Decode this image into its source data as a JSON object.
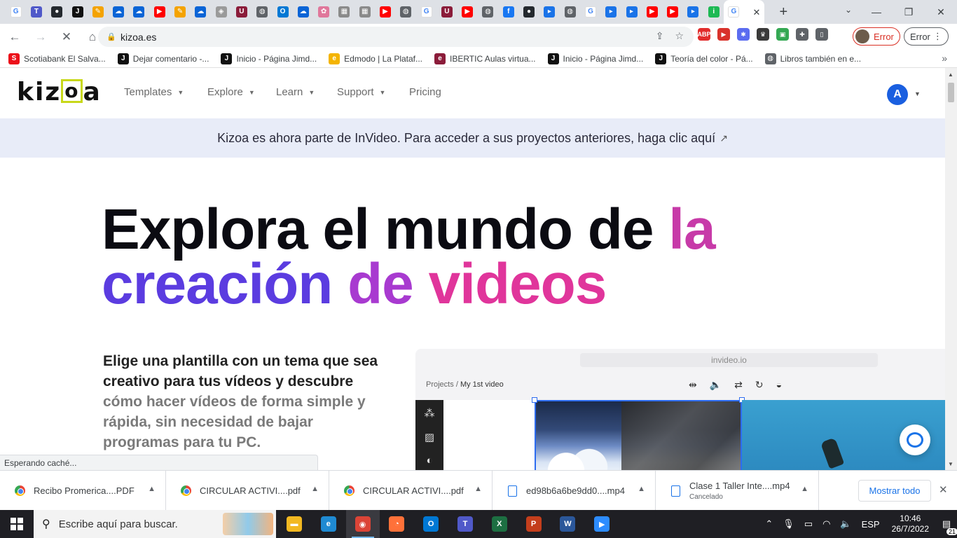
{
  "browser": {
    "tabs": [
      {
        "icon": "google-icon",
        "color": "#ffffff",
        "glyph": "G"
      },
      {
        "icon": "teams-icon",
        "color": "#5059c9",
        "glyph": "T"
      },
      {
        "icon": "github-icon",
        "color": "#24292e",
        "glyph": "●"
      },
      {
        "icon": "jimdo-icon",
        "color": "#111111",
        "glyph": "J"
      },
      {
        "icon": "pencil-icon",
        "color": "#f4a300",
        "glyph": "✎"
      },
      {
        "icon": "onedrive-icon",
        "color": "#0a64d6",
        "glyph": "☁"
      },
      {
        "icon": "onedrive-icon",
        "color": "#0a64d6",
        "glyph": "☁"
      },
      {
        "icon": "youtube-icon",
        "color": "#ff0000",
        "glyph": "▶"
      },
      {
        "icon": "pencil-icon",
        "color": "#f4a300",
        "glyph": "✎"
      },
      {
        "icon": "onedrive-icon",
        "color": "#0a64d6",
        "glyph": "☁"
      },
      {
        "icon": "crest-icon",
        "color": "#9a9a9a",
        "glyph": "◈"
      },
      {
        "icon": "u-icon",
        "color": "#8b1c3a",
        "glyph": "U"
      },
      {
        "icon": "globe-icon",
        "color": "#5f6368",
        "glyph": "◍"
      },
      {
        "icon": "outlook-icon",
        "color": "#0078d4",
        "glyph": "O"
      },
      {
        "icon": "onedrive-icon",
        "color": "#0a64d6",
        "glyph": "☁"
      },
      {
        "icon": "brain-icon",
        "color": "#e0779b",
        "glyph": "✿"
      },
      {
        "icon": "grid-icon",
        "color": "#8a8a8a",
        "glyph": "▦"
      },
      {
        "icon": "grid-icon",
        "color": "#8a8a8a",
        "glyph": "▦"
      },
      {
        "icon": "youtube-icon",
        "color": "#ff0000",
        "glyph": "▶"
      },
      {
        "icon": "globe-icon",
        "color": "#5f6368",
        "glyph": "◍"
      },
      {
        "icon": "google-icon",
        "color": "#ffffff",
        "glyph": "G"
      },
      {
        "icon": "u-icon",
        "color": "#8b1c3a",
        "glyph": "U"
      },
      {
        "icon": "youtube-icon",
        "color": "#ff0000",
        "glyph": "▶"
      },
      {
        "icon": "globe-icon",
        "color": "#5f6368",
        "glyph": "◍"
      },
      {
        "icon": "facebook-icon",
        "color": "#1877f2",
        "glyph": "f"
      },
      {
        "icon": "github-icon",
        "color": "#24292e",
        "glyph": "●"
      },
      {
        "icon": "play-icon",
        "color": "#1a73e8",
        "glyph": "▸"
      },
      {
        "icon": "globe-icon",
        "color": "#5f6368",
        "glyph": "◍"
      },
      {
        "icon": "google-icon",
        "color": "#ffffff",
        "glyph": "G"
      },
      {
        "icon": "play-icon",
        "color": "#1a73e8",
        "glyph": "▸"
      },
      {
        "icon": "play-icon",
        "color": "#1a73e8",
        "glyph": "▸"
      },
      {
        "icon": "youtube-icon",
        "color": "#ff0000",
        "glyph": "▶"
      },
      {
        "icon": "youtube-icon",
        "color": "#ff0000",
        "glyph": "▶"
      },
      {
        "icon": "play-icon",
        "color": "#1a73e8",
        "glyph": "▸"
      },
      {
        "icon": "invideo-icon",
        "color": "#1db954",
        "glyph": "i"
      }
    ],
    "active_tab": {
      "icon": "google-icon",
      "close": "✕"
    },
    "new_tab": "+",
    "window_controls": [
      "—",
      "❐",
      "✕"
    ],
    "tab_search": "⌄",
    "nav": {
      "back": "←",
      "forward": "→",
      "reload": "✕",
      "home": "⌂"
    },
    "url": "kizoa.es",
    "profile_status": "Error",
    "error_button": "Error",
    "extensions": [
      {
        "name": "adblock-icon",
        "color": "#e22c2c",
        "glyph": "ABP"
      },
      {
        "name": "screencast-icon",
        "color": "#d9322b",
        "glyph": "▶"
      },
      {
        "name": "flower-icon",
        "color": "#5b6cf0",
        "glyph": "✱"
      },
      {
        "name": "crown-icon",
        "color": "#3a3a3a",
        "glyph": "♛"
      },
      {
        "name": "green-ext-icon",
        "color": "#34a853",
        "glyph": "▣"
      },
      {
        "name": "puzzle-icon",
        "color": "#5f6368",
        "glyph": "✚"
      },
      {
        "name": "sidepanel-icon",
        "color": "#5f6368",
        "glyph": "▯"
      }
    ],
    "bookmarks": [
      {
        "label": "Scotiabank El Salva...",
        "color": "#ec111a",
        "glyph": "S",
        "icon": "scotiabank-icon"
      },
      {
        "label": "Dejar comentario -...",
        "color": "#111111",
        "glyph": "J",
        "icon": "jimdo-icon"
      },
      {
        "label": "Inicio - Página Jimd...",
        "color": "#111111",
        "glyph": "J",
        "icon": "jimdo-icon"
      },
      {
        "label": "Edmodo | La Plataf...",
        "color": "#f4b400",
        "glyph": "e",
        "icon": "edmodo-icon"
      },
      {
        "label": "IBERTIC Aulas virtua...",
        "color": "#8b1c3a",
        "glyph": "e",
        "icon": "ibertic-icon"
      },
      {
        "label": "Inicio - Página Jimd...",
        "color": "#111111",
        "glyph": "J",
        "icon": "jimdo-icon"
      },
      {
        "label": "Teoría del color - Pá...",
        "color": "#111111",
        "glyph": "J",
        "icon": "jimdo-icon"
      },
      {
        "label": "Libros también en e...",
        "color": "#5f6368",
        "glyph": "◍",
        "icon": "globe-icon"
      }
    ],
    "bookmarks_more": "»",
    "status": "Esperando caché..."
  },
  "site": {
    "logo": "kizoa",
    "nav": [
      {
        "label": "Templates",
        "dropdown": true
      },
      {
        "label": "Explore",
        "dropdown": true
      },
      {
        "label": "Learn",
        "dropdown": true
      },
      {
        "label": "Support",
        "dropdown": true
      },
      {
        "label": "Pricing",
        "dropdown": false
      }
    ],
    "user_initial": "A",
    "banner": "Kizoa es ahora parte de InVideo. Para acceder a sus proyectos anteriores, haga clic aquí",
    "hero_line1": "Explora el mundo de ",
    "hero_line1_accent": "la",
    "hero_line2": "creación de videos",
    "hero_gradient": [
      "#5b3ce0",
      "#a83ad0",
      "#e0359b"
    ],
    "desc_strong": "Elige una plantilla con un tema que sea creativo para tus vídeos y descubre",
    "desc_muted": " cómo hacer vídeos de forma simple y rápida, sin necesidad de bajar programas para tu PC.",
    "mock": {
      "address": "invideo.io",
      "crumb_root": "Projects",
      "crumb_sep": "/",
      "crumb_current": "My 1st video",
      "tools": [
        "⇹",
        "🔈",
        "⇄",
        "↻",
        "◒"
      ],
      "sidebar": [
        "⁂",
        "▨",
        "◐"
      ]
    }
  },
  "downloads": {
    "items": [
      {
        "name": "Recibo Promerica....PDF",
        "sub": "",
        "type": "chrome"
      },
      {
        "name": "CIRCULAR ACTIVI....pdf",
        "sub": "",
        "type": "chrome"
      },
      {
        "name": "CIRCULAR ACTIVI....pdf",
        "sub": "",
        "type": "chrome"
      },
      {
        "name": "ed98b6a6be9dd0....mp4",
        "sub": "",
        "type": "file"
      },
      {
        "name": "Clase 1 Taller Inte....mp4",
        "sub": "Cancelado",
        "type": "file"
      }
    ],
    "show_all": "Mostrar todo",
    "close": "✕"
  },
  "taskbar": {
    "search_placeholder": "Escribe aquí para buscar.",
    "apps": [
      {
        "name": "file-explorer-icon",
        "color": "#f2b821",
        "glyph": "▬"
      },
      {
        "name": "edge-icon",
        "color": "#1f8ad2",
        "glyph": "e"
      },
      {
        "name": "chrome-icon",
        "color": "#db4437",
        "glyph": "◉"
      },
      {
        "name": "firefox-icon",
        "color": "#ff7139",
        "glyph": "◔"
      },
      {
        "name": "outlook-icon",
        "color": "#0078d4",
        "glyph": "O"
      },
      {
        "name": "teams-icon",
        "color": "#5059c9",
        "glyph": "T"
      },
      {
        "name": "excel-icon",
        "color": "#1d6f42",
        "glyph": "X"
      },
      {
        "name": "powerpoint-icon",
        "color": "#c43e1c",
        "glyph": "P"
      },
      {
        "name": "word-icon",
        "color": "#2b579a",
        "glyph": "W"
      },
      {
        "name": "zoom-icon",
        "color": "#2d8cff",
        "glyph": "▶"
      }
    ],
    "active_app": 2,
    "tray_chevron": "⌃",
    "language": "ESP",
    "time": "10:46",
    "date": "26/7/2022",
    "notification_count": "21"
  }
}
